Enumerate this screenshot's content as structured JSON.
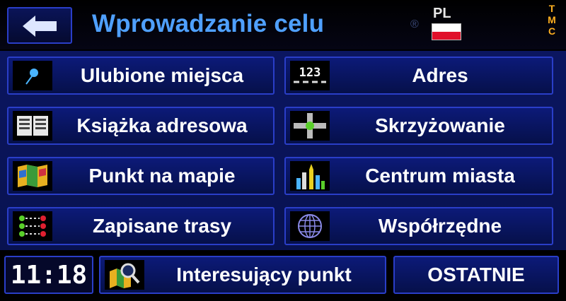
{
  "header": {
    "title": "Wprowadzanie celu",
    "registered_mark": "®",
    "language": "PL",
    "tmc_letters": [
      "T",
      "M",
      "C"
    ]
  },
  "menu": {
    "favorites": "Ulubione miejsca",
    "address": "Adres",
    "address_icon_text": "123",
    "address_book": "Książka adresowa",
    "intersection": "Skrzyżowanie",
    "map_point": "Punkt na mapie",
    "city_center": "Centrum miasta",
    "saved_routes": "Zapisane trasy",
    "coordinates": "Współrzędne"
  },
  "footer": {
    "time": "11:18",
    "poi": "Interesujący punkt",
    "recent": "OSTATNIE"
  },
  "colors": {
    "title": "#4fa0ff",
    "border": "#2a3ec8",
    "tmc": "#ffb020",
    "flag_red": "#e0102a"
  }
}
